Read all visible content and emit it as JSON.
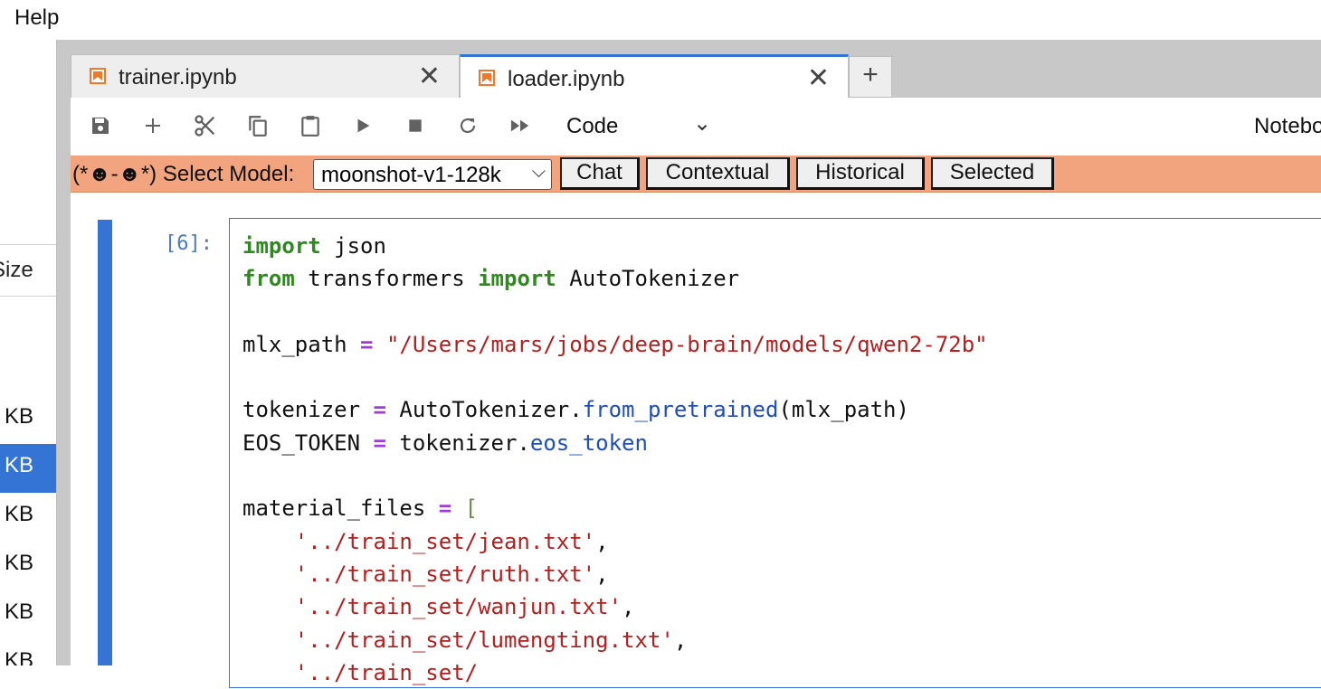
{
  "menu": {
    "help": "Help"
  },
  "sidebar": {
    "column_header": "Size",
    "sizes": [
      {
        "label": "KB",
        "selected": false
      },
      {
        "label": "KB",
        "selected": true
      },
      {
        "label": "KB",
        "selected": false
      },
      {
        "label": "KB",
        "selected": false
      },
      {
        "label": "KB",
        "selected": false
      },
      {
        "label": "KB",
        "selected": false
      }
    ]
  },
  "tabs": [
    {
      "label": "trainer.ipynb",
      "active": false
    },
    {
      "label": "loader.ipynb",
      "active": true
    }
  ],
  "tab_close_glyph": "✕",
  "tab_add_glyph": "+",
  "toolbar": {
    "icons": [
      "save-icon",
      "add-cell-icon",
      "cut-icon",
      "copy-icon",
      "paste-icon",
      "run-icon",
      "stop-icon",
      "restart-icon",
      "fast-forward-icon"
    ],
    "cell_type": "Code",
    "kernel_label": "Notebook"
  },
  "ai_bar": {
    "label": "(*☻-☻*) Select Model:",
    "model": "moonshot-v1-128k",
    "buttons": [
      "Chat",
      "Contextual",
      "Historical",
      "Selected"
    ]
  },
  "cell": {
    "prompt": "[6]:",
    "code_lines": [
      "import json",
      "from transformers import AutoTokenizer",
      "",
      "mlx_path = \"/Users/mars/jobs/deep-brain/models/qwen2-72b\"",
      "",
      "tokenizer = AutoTokenizer.from_pretrained(mlx_path)",
      "EOS_TOKEN = tokenizer.eos_token",
      "",
      "material_files = [",
      "    '../train_set/jean.txt',",
      "    '../train_set/ruth.txt',",
      "    '../train_set/wanjun.txt',",
      "    '../train_set/lumengting.txt',",
      "    '../train_set/"
    ]
  },
  "colors": {
    "accent": "#3474d4",
    "ai_bar": "#f2a47e",
    "keyword": "#2f8a1e",
    "string": "#b21f1f",
    "operator": "#a33bd8",
    "attribute": "#1f4fb5"
  }
}
